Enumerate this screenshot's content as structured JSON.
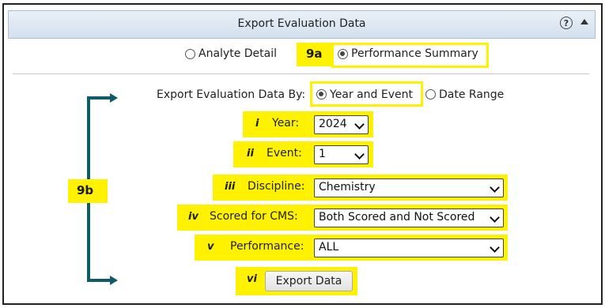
{
  "header": {
    "title": "Export Evaluation Data",
    "help_icon": "question-circle-icon",
    "collapse_icon": "triangle-up-icon"
  },
  "report_type": {
    "options": [
      "Analyte Detail",
      "Performance Summary"
    ],
    "selected": "Performance Summary",
    "callout": "9a"
  },
  "export_by": {
    "label": "Export Evaluation Data By:",
    "options": [
      "Year and Event",
      "Date Range"
    ],
    "selected": "Year and Event"
  },
  "filters": {
    "callout": "9b",
    "year": {
      "marker": "i",
      "label": "Year:",
      "value": "2024"
    },
    "event": {
      "marker": "ii",
      "label": "Event:",
      "value": "1"
    },
    "discipline": {
      "marker": "iii",
      "label": "Discipline:",
      "value": "Chemistry"
    },
    "scored": {
      "marker": "iv",
      "label": "Scored for CMS:",
      "value": "Both Scored and Not Scored"
    },
    "performance": {
      "marker": "v",
      "label": "Performance:",
      "value": "ALL"
    }
  },
  "export": {
    "marker": "vi",
    "label": "Export Data"
  },
  "colors": {
    "highlight": "#fff200",
    "bracket": "#0f5a6b",
    "header_bg": "#dfe8f3"
  }
}
